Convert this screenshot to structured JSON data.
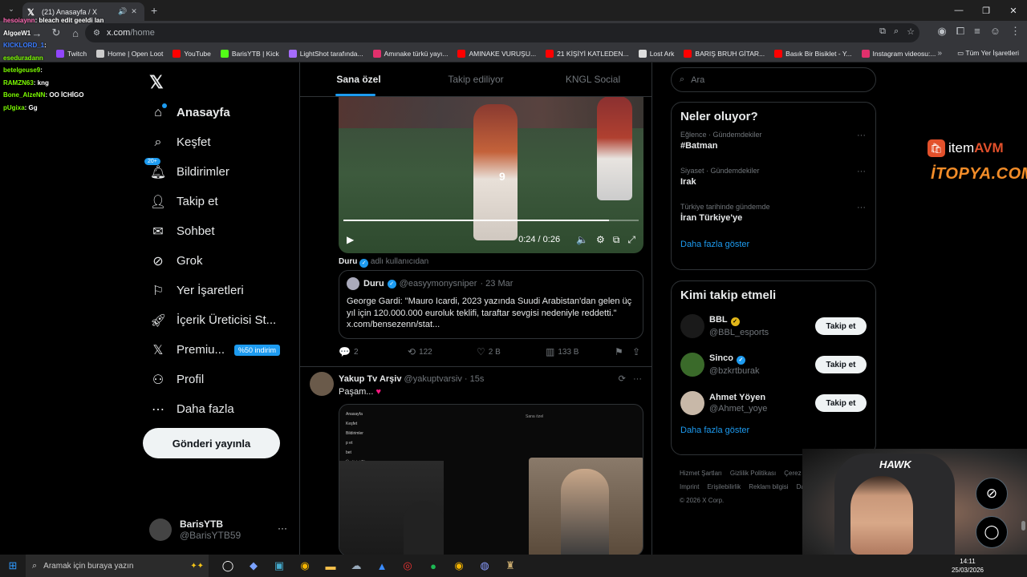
{
  "browser": {
    "tab_title": "(21) Anasayfa / X",
    "url_host": "x.com",
    "url_path": "/home",
    "bookmarks": [
      {
        "label": "Twitch",
        "color": "#9146ff"
      },
      {
        "label": "Home | Open Loot",
        "color": "#cccccc"
      },
      {
        "label": "YouTube",
        "color": "#ff0000"
      },
      {
        "label": "BarisYTB | Kick",
        "color": "#53fc18"
      },
      {
        "label": "LightShot tarafında...",
        "color": "#a66cff"
      },
      {
        "label": "Amınake türkü yayı...",
        "color": "#e1306c"
      },
      {
        "label": "AMINAKE VURUŞU...",
        "color": "#ff0000"
      },
      {
        "label": "21 KİŞİYİ KATLEDEN...",
        "color": "#ff0000"
      },
      {
        "label": "Lost Ark",
        "color": "#dddddd"
      },
      {
        "label": "BARIŞ BRUH GİTAR...",
        "color": "#ff0000"
      },
      {
        "label": "Basık Bir Bisiklet - Y...",
        "color": "#ff0000"
      },
      {
        "label": "Instagram videosu:...",
        "color": "#e1306c"
      }
    ],
    "all_bookmarks": "Tüm Yer İşaretleri"
  },
  "chat": [
    {
      "user": "hesoiaynn",
      "msg": ": bleach edit geeldi lan",
      "color": "#ff69b4"
    },
    {
      "user": "AlgoeW1",
      "msg": "",
      "color": "#ffffff"
    },
    {
      "user": "KICKLORD_1",
      "msg": ":",
      "color": "#3a7bff"
    },
    {
      "user": "eseduradann",
      "msg": "",
      "color": "#7cfc00"
    },
    {
      "user": "betelgeuse9",
      "msg": ":",
      "color": "#7cfc00"
    },
    {
      "user": "RAMZN63",
      "msg": ": kng",
      "color": "#7cfc00"
    },
    {
      "user": "Bone_AlzeNN",
      "msg": ": OO İCHİGO",
      "color": "#7cfc00"
    },
    {
      "user": "pUgixa",
      "msg": ": Gg",
      "color": "#7cfc00"
    }
  ],
  "sidebar": {
    "items": [
      {
        "label": "Anasayfa",
        "icon": "home-icon"
      },
      {
        "label": "Keşfet",
        "icon": "search-icon"
      },
      {
        "label": "Bildirimler",
        "icon": "bell-icon",
        "badge": "20+"
      },
      {
        "label": "Takip et",
        "icon": "follow-icon"
      },
      {
        "label": "Sohbet",
        "icon": "mail-icon"
      },
      {
        "label": "Grok",
        "icon": "grok-icon"
      },
      {
        "label": "Yer İşaretleri",
        "icon": "bookmark-icon"
      },
      {
        "label": "İçerik Üreticisi St...",
        "icon": "rocket-icon"
      },
      {
        "label": "Premiu...",
        "icon": "x-icon",
        "promo": "%50 indirim"
      },
      {
        "label": "Profil",
        "icon": "person-icon"
      },
      {
        "label": "Daha fazla",
        "icon": "more-icon"
      }
    ],
    "post_button": "Gönderi yayınla",
    "account": {
      "name": "BarisYTB",
      "handle": "@BarisYTB59"
    }
  },
  "feed": {
    "tabs": [
      "Sana özel",
      "Takip ediliyor",
      "KNGL Social"
    ],
    "video": {
      "time": "0:24 / 0:26",
      "progress": 0.9,
      "jersey": "9"
    },
    "via_user": "Duru",
    "via_text": "adlı kullanıcıdan",
    "quote": {
      "name": "Duru",
      "handle": "@easyymonysniper",
      "date": "· 23 Mar",
      "text": "George Gardi: \"Mauro Icardi, 2023 yazında Suudi Arabistan'dan gelen üç yıl için 120.000.000 euroluk teklifi, taraftar sevgisi nedeniyle reddetti.\" x.com/bensezenn/stat..."
    },
    "actions": {
      "replies": "2",
      "reposts": "122",
      "likes": "2 B",
      "views": "133 B"
    },
    "post2": {
      "name": "Yakup Tv Arşiv",
      "handle": "@yakuptvarsiv",
      "time": "· 15s",
      "text": "Paşam...",
      "media_nav": [
        "Anasayfa",
        "Keşfet",
        "Bildirimler",
        "p et",
        "bet",
        "",
        "Üreticisi St...",
        "",
        "fazla"
      ],
      "media_tabs": "Sana özel"
    }
  },
  "right": {
    "search_placeholder": "Ara",
    "trends_title": "Neler oluyor?",
    "trends": [
      {
        "context": "Eğlence · Gündemdekiler",
        "title": "#Batman"
      },
      {
        "context": "Siyaset · Gündemdekiler",
        "title": "Irak"
      },
      {
        "context": "Türkiye tarihinde gündemde",
        "title": "İran Türkiye'ye"
      }
    ],
    "show_more": "Daha fazla göster",
    "wtf_title": "Kimi takip etmeli",
    "wtf": [
      {
        "name": "BBL",
        "handle": "@BBL_esports",
        "badge": "gold",
        "avatar_color": "#1a1a1a"
      },
      {
        "name": "Sinco",
        "handle": "@bzkrtburak",
        "badge": "blue",
        "avatar_color": "#3a6a2a"
      },
      {
        "name": "Ahmet Yöyen",
        "handle": "@Ahmet_yoye",
        "badge": "",
        "avatar_color": "#c8b8a8"
      }
    ],
    "follow_label": "Takip et",
    "footer": [
      "Hizmet Şartları",
      "Gizlilik Politikası",
      "Çerez Politikası",
      "Imprint",
      "Erişilebilirlik",
      "Reklam bilgisi",
      "Daha fazla",
      "© 2026 X Corp."
    ]
  },
  "overlays": {
    "itemavm_item": "item",
    "itemavm_avm": "AVM",
    "itopya": "İTOPYA.COM",
    "cam_logo": "HAWK"
  },
  "taskbar": {
    "search_placeholder": "Aramak için buraya yazın",
    "time": "14:11",
    "date": "25/03/2026"
  }
}
